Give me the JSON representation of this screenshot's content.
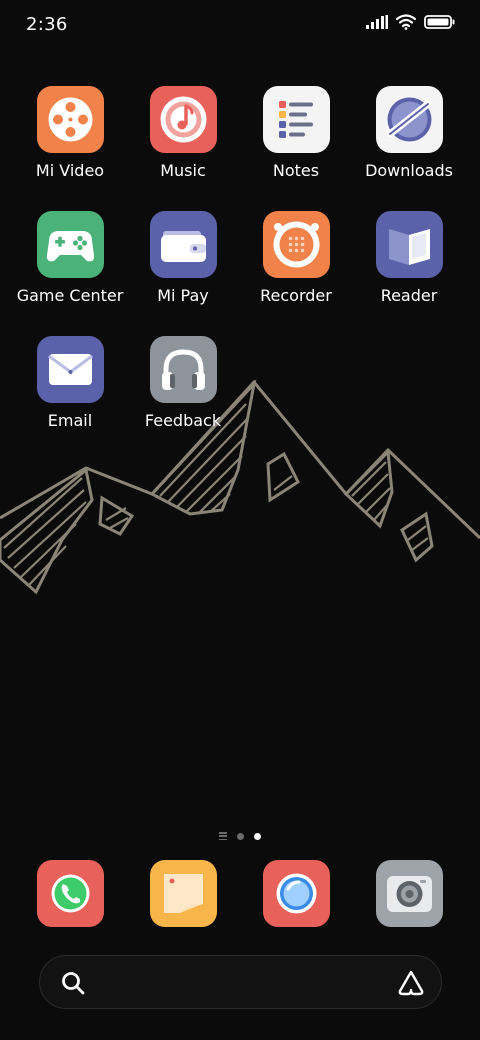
{
  "status_bar": {
    "time": "2:36",
    "icons": [
      "signal-icon",
      "wifi-icon",
      "battery-icon"
    ]
  },
  "apps": [
    {
      "label": "Mi Video",
      "icon": "mi-video-icon",
      "color": "#F0824A"
    },
    {
      "label": "Music",
      "icon": "music-icon",
      "color": "#E8615A"
    },
    {
      "label": "Notes",
      "icon": "notes-icon",
      "color": "#F4F4F4"
    },
    {
      "label": "Downloads",
      "icon": "downloads-icon",
      "color": "#F4F4F4"
    },
    {
      "label": "Game Center",
      "icon": "game-center-icon",
      "color": "#4BB27A"
    },
    {
      "label": "Mi Pay",
      "icon": "wallet-icon",
      "color": "#5B62AA"
    },
    {
      "label": "Recorder",
      "icon": "recorder-icon",
      "color": "#F0824A"
    },
    {
      "label": "Reader",
      "icon": "reader-icon",
      "color": "#5B62AA"
    },
    {
      "label": "Email",
      "icon": "email-icon",
      "color": "#5B62AA"
    },
    {
      "label": "Feedback",
      "icon": "headphones-icon",
      "color": "#8E949B"
    }
  ],
  "page_indicator": {
    "pages": 3,
    "active_index": 2
  },
  "dock": [
    {
      "name": "phone",
      "icon": "phone-icon",
      "color": "#E8615A"
    },
    {
      "name": "messages",
      "icon": "messages-icon",
      "color": "#F7B54A"
    },
    {
      "name": "browser",
      "icon": "browser-icon",
      "color": "#E8615A"
    },
    {
      "name": "camera",
      "icon": "camera-icon",
      "color": "#9EA3AA"
    }
  ],
  "search": {
    "placeholder": "",
    "search_icon": "search-icon",
    "assistant_icon": "assistant-icon"
  }
}
